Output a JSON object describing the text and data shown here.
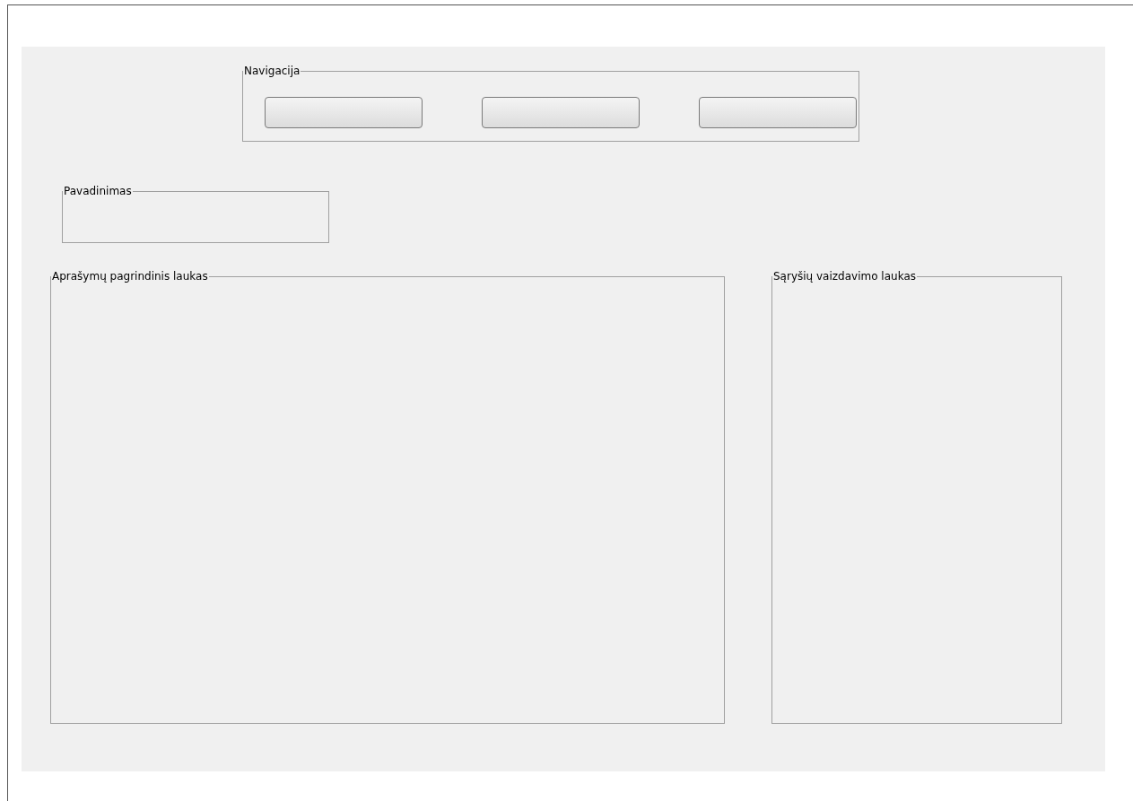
{
  "navigation": {
    "legend": "Navigacija",
    "buttons": [
      {
        "kind": "push"
      },
      {
        "kind": "push"
      },
      {
        "kind": "push"
      }
    ]
  },
  "title_group": {
    "legend": "Pavadinimas"
  },
  "panels": [
    {
      "legend": "Aprašymų pagrindinis laukas"
    },
    {
      "legend": "Sąryšių vaizdavimo laukas"
    }
  ]
}
